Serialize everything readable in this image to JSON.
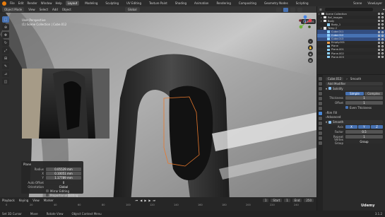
{
  "topbar": {
    "menus": [
      "File",
      "Edit",
      "Render",
      "Window",
      "Help"
    ],
    "workspaces": [
      "Layout",
      "Modeling",
      "Sculpting",
      "UV Editing",
      "Texture Paint",
      "Shading",
      "Animation",
      "Rendering",
      "Compositing",
      "Geometry Nodes",
      "Scripting"
    ],
    "active_workspace": "Layout",
    "scene": "Scene",
    "view_layer": "ViewLayer"
  },
  "viewport": {
    "mode": "Object Mode",
    "menus": [
      "View",
      "Select",
      "Add",
      "Object"
    ],
    "transform": "Global",
    "view_name": "User Perspective",
    "collection_path": "(1) Scene Collection | Cube.012",
    "options_label": "Options"
  },
  "operator_panel": {
    "title": "Plane",
    "fields": [
      {
        "label": "Radius",
        "value": "0.05529 mm"
      },
      {
        "label": "X",
        "value": "0.10051 mm"
      },
      {
        "label": "Y",
        "value": "1.17789 mm"
      },
      {
        "label": "Auto Offset",
        "value": "0"
      },
      {
        "label": "Orientation",
        "value": "Global"
      }
    ],
    "checkboxes": [
      "Mirror Editing",
      "Proportional Editing"
    ]
  },
  "timeline": {
    "menus": [
      "Playback",
      "Keying",
      "View",
      "Marker"
    ],
    "current_frame": "1",
    "start_label": "Start",
    "start": "1",
    "end_label": "End",
    "end": "250",
    "ticks": [
      "0",
      "20",
      "40",
      "60",
      "80",
      "100",
      "120",
      "140",
      "160",
      "180",
      "200",
      "220",
      "240"
    ]
  },
  "statusbar": {
    "items": [
      "Set 3D Cursor",
      "Move",
      "Rotate View",
      "Object Context Menu"
    ],
    "version": "3.1.2"
  },
  "outliner": {
    "rows": [
      {
        "name": "Scene Collection",
        "type": "coll",
        "state": ""
      },
      {
        "name": "Ref_Images",
        "type": "coll",
        "state": ""
      },
      {
        "name": "Body",
        "type": "coll",
        "state": ""
      },
      {
        "name": "Body_1",
        "type": "mesh",
        "state": ""
      },
      {
        "name": "Temp 2",
        "type": "coll",
        "state": ""
      },
      {
        "name": "Cube.011",
        "type": "mesh",
        "state": "selected"
      },
      {
        "name": "Cube.012",
        "type": "mesh",
        "state": "active"
      },
      {
        "name": "Cube.013",
        "type": "mesh",
        "state": "selected"
      },
      {
        "name": "Empty.001",
        "type": "obj",
        "state": ""
      },
      {
        "name": "Plane",
        "type": "mesh",
        "state": ""
      },
      {
        "name": "Plane.001",
        "type": "mesh",
        "state": ""
      },
      {
        "name": "Plane.002",
        "type": "mesh",
        "state": ""
      },
      {
        "name": "Plane.003",
        "type": "mesh",
        "state": ""
      }
    ]
  },
  "properties": {
    "object_name": "Cube.012",
    "modifier_stack": "Smooth",
    "add_modifier": "Add Modifier",
    "solidify": {
      "name": "Solidify",
      "mode_options": [
        "Simple",
        "Complex"
      ],
      "active_mode": "Simple",
      "fields": [
        {
          "label": "Thickness",
          "value": "1"
        },
        {
          "label": "Offset",
          "value": "1"
        }
      ],
      "even_label": "Even Thickness",
      "rim_label": "Rim Fill",
      "advanced_label": "Advanced"
    },
    "smooth": {
      "name": "Smooth",
      "axis_label": "Axis",
      "axes": [
        "X",
        "Y",
        "Z"
      ],
      "factor_label": "Factor",
      "factor": "0.5",
      "repeat_label": "Repeat",
      "repeat": "1",
      "vgroup_label": "Vertex Group",
      "vgroup": "Group"
    }
  },
  "colors": {
    "accent": "#4772b3",
    "selection_outline": "#e8782c",
    "active_object": "#f0a24a"
  },
  "watermark": "Udemy"
}
